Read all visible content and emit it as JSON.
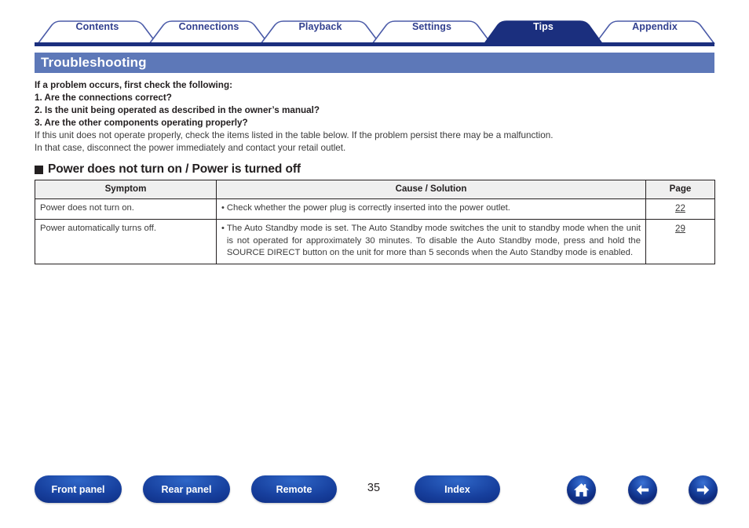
{
  "nav_tabs": [
    {
      "label": "Contents",
      "active": false
    },
    {
      "label": "Connections",
      "active": false
    },
    {
      "label": "Playback",
      "active": false
    },
    {
      "label": "Settings",
      "active": false
    },
    {
      "label": "Tips",
      "active": true
    },
    {
      "label": "Appendix",
      "active": false
    }
  ],
  "title_bar": {
    "title": "Troubleshooting"
  },
  "intro": {
    "lines": [
      {
        "text": "If a problem occurs, first check the following:",
        "bold": true
      },
      {
        "text": "1. Are the connections correct?",
        "bold": true
      },
      {
        "text": "2. Is the unit being operated as described in the owner’s manual?",
        "bold": true
      },
      {
        "text": "3. Are the other components operating properly?",
        "bold": true
      },
      {
        "text": "If this unit does not operate properly, check the items listed in the table below. If the problem persist there may be a malfunction.",
        "bold": false
      },
      {
        "text": "In that case, disconnect the power immediately and contact your retail outlet.",
        "bold": false
      }
    ]
  },
  "section": {
    "bullet": "■",
    "heading": "Power does not turn on / Power is turned off"
  },
  "table": {
    "headers": [
      "Symptom",
      "Cause / Solution",
      "Page"
    ],
    "rows": [
      {
        "symptom": "Power does not turn on.",
        "bullet": "•",
        "cause": "Check whether the power plug is correctly inserted into the power outlet.",
        "page": "22",
        "justify": false
      },
      {
        "symptom": "Power automatically turns off.",
        "bullet": "•",
        "cause": "The Auto Standby mode is set. The Auto Standby mode switches the unit to standby mode when the unit is not operated for approximately 30 minutes. To disable the Auto Standby mode, press and hold the SOURCE DIRECT button on the unit for more than 5 seconds when the Auto Standby mode is enabled.",
        "page": "29",
        "justify": true
      }
    ]
  },
  "footer": {
    "buttons": [
      {
        "label": "Front panel"
      },
      {
        "label": "Rear panel"
      },
      {
        "label": "Remote"
      },
      {
        "label": "Index"
      }
    ],
    "page_number": "35",
    "icons": [
      {
        "name": "home-icon"
      },
      {
        "name": "arrow-left-icon"
      },
      {
        "name": "arrow-right-icon"
      }
    ]
  },
  "colors": {
    "tab_navy": "#1b2f7e",
    "tab_outline": "#4b5ba8",
    "tab_text": "#32408f",
    "title_bar_bg": "#5d78b8",
    "table_header_bg": "#efefef",
    "button_blue": "#17409e"
  }
}
